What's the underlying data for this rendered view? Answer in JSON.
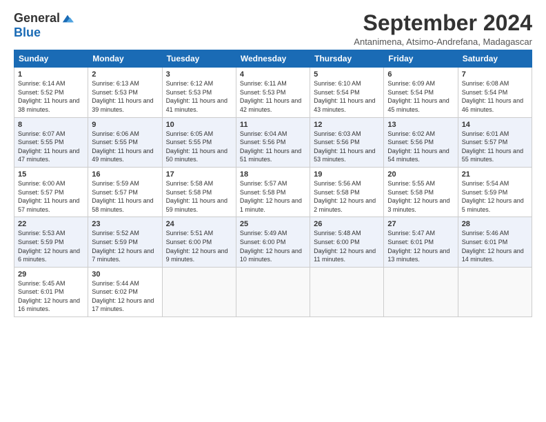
{
  "logo": {
    "general": "General",
    "blue": "Blue"
  },
  "title": "September 2024",
  "location": "Antanimena, Atsimo-Andrefana, Madagascar",
  "days_header": [
    "Sunday",
    "Monday",
    "Tuesday",
    "Wednesday",
    "Thursday",
    "Friday",
    "Saturday"
  ],
  "weeks": [
    [
      {
        "day": "1",
        "sunrise": "6:14 AM",
        "sunset": "5:52 PM",
        "daylight": "11 hours and 38 minutes."
      },
      {
        "day": "2",
        "sunrise": "6:13 AM",
        "sunset": "5:53 PM",
        "daylight": "11 hours and 39 minutes."
      },
      {
        "day": "3",
        "sunrise": "6:12 AM",
        "sunset": "5:53 PM",
        "daylight": "11 hours and 41 minutes."
      },
      {
        "day": "4",
        "sunrise": "6:11 AM",
        "sunset": "5:53 PM",
        "daylight": "11 hours and 42 minutes."
      },
      {
        "day": "5",
        "sunrise": "6:10 AM",
        "sunset": "5:54 PM",
        "daylight": "11 hours and 43 minutes."
      },
      {
        "day": "6",
        "sunrise": "6:09 AM",
        "sunset": "5:54 PM",
        "daylight": "11 hours and 45 minutes."
      },
      {
        "day": "7",
        "sunrise": "6:08 AM",
        "sunset": "5:54 PM",
        "daylight": "11 hours and 46 minutes."
      }
    ],
    [
      {
        "day": "8",
        "sunrise": "6:07 AM",
        "sunset": "5:55 PM",
        "daylight": "11 hours and 47 minutes."
      },
      {
        "day": "9",
        "sunrise": "6:06 AM",
        "sunset": "5:55 PM",
        "daylight": "11 hours and 49 minutes."
      },
      {
        "day": "10",
        "sunrise": "6:05 AM",
        "sunset": "5:55 PM",
        "daylight": "11 hours and 50 minutes."
      },
      {
        "day": "11",
        "sunrise": "6:04 AM",
        "sunset": "5:56 PM",
        "daylight": "11 hours and 51 minutes."
      },
      {
        "day": "12",
        "sunrise": "6:03 AM",
        "sunset": "5:56 PM",
        "daylight": "11 hours and 53 minutes."
      },
      {
        "day": "13",
        "sunrise": "6:02 AM",
        "sunset": "5:56 PM",
        "daylight": "11 hours and 54 minutes."
      },
      {
        "day": "14",
        "sunrise": "6:01 AM",
        "sunset": "5:57 PM",
        "daylight": "11 hours and 55 minutes."
      }
    ],
    [
      {
        "day": "15",
        "sunrise": "6:00 AM",
        "sunset": "5:57 PM",
        "daylight": "11 hours and 57 minutes."
      },
      {
        "day": "16",
        "sunrise": "5:59 AM",
        "sunset": "5:57 PM",
        "daylight": "11 hours and 58 minutes."
      },
      {
        "day": "17",
        "sunrise": "5:58 AM",
        "sunset": "5:58 PM",
        "daylight": "11 hours and 59 minutes."
      },
      {
        "day": "18",
        "sunrise": "5:57 AM",
        "sunset": "5:58 PM",
        "daylight": "12 hours and 1 minute."
      },
      {
        "day": "19",
        "sunrise": "5:56 AM",
        "sunset": "5:58 PM",
        "daylight": "12 hours and 2 minutes."
      },
      {
        "day": "20",
        "sunrise": "5:55 AM",
        "sunset": "5:58 PM",
        "daylight": "12 hours and 3 minutes."
      },
      {
        "day": "21",
        "sunrise": "5:54 AM",
        "sunset": "5:59 PM",
        "daylight": "12 hours and 5 minutes."
      }
    ],
    [
      {
        "day": "22",
        "sunrise": "5:53 AM",
        "sunset": "5:59 PM",
        "daylight": "12 hours and 6 minutes."
      },
      {
        "day": "23",
        "sunrise": "5:52 AM",
        "sunset": "5:59 PM",
        "daylight": "12 hours and 7 minutes."
      },
      {
        "day": "24",
        "sunrise": "5:51 AM",
        "sunset": "6:00 PM",
        "daylight": "12 hours and 9 minutes."
      },
      {
        "day": "25",
        "sunrise": "5:49 AM",
        "sunset": "6:00 PM",
        "daylight": "12 hours and 10 minutes."
      },
      {
        "day": "26",
        "sunrise": "5:48 AM",
        "sunset": "6:00 PM",
        "daylight": "12 hours and 11 minutes."
      },
      {
        "day": "27",
        "sunrise": "5:47 AM",
        "sunset": "6:01 PM",
        "daylight": "12 hours and 13 minutes."
      },
      {
        "day": "28",
        "sunrise": "5:46 AM",
        "sunset": "6:01 PM",
        "daylight": "12 hours and 14 minutes."
      }
    ],
    [
      {
        "day": "29",
        "sunrise": "5:45 AM",
        "sunset": "6:01 PM",
        "daylight": "12 hours and 16 minutes."
      },
      {
        "day": "30",
        "sunrise": "5:44 AM",
        "sunset": "6:02 PM",
        "daylight": "12 hours and 17 minutes."
      },
      null,
      null,
      null,
      null,
      null
    ]
  ]
}
